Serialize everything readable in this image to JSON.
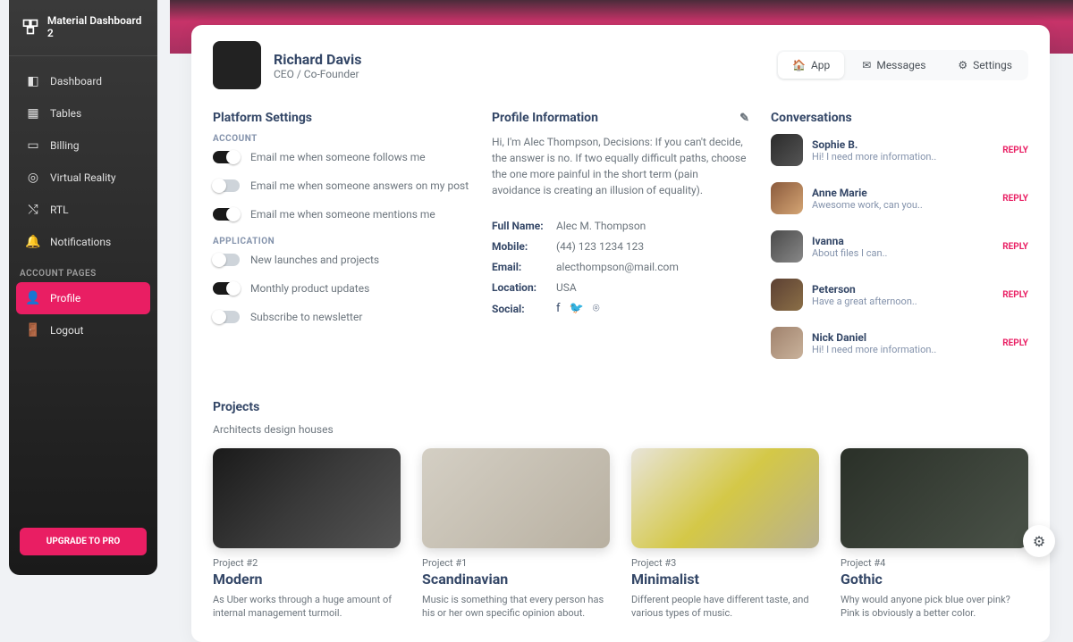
{
  "brand": "Material Dashboard 2",
  "sidebar": {
    "items": [
      {
        "label": "Dashboard"
      },
      {
        "label": "Tables"
      },
      {
        "label": "Billing"
      },
      {
        "label": "Virtual Reality"
      },
      {
        "label": "RTL"
      },
      {
        "label": "Notifications"
      }
    ],
    "account_header": "ACCOUNT PAGES",
    "account_items": [
      {
        "label": "Profile",
        "active": true
      },
      {
        "label": "Logout"
      }
    ],
    "upgrade": "UPGRADE TO PRO"
  },
  "profile": {
    "name": "Richard Davis",
    "role": "CEO / Co-Founder"
  },
  "tabs": [
    {
      "label": "App",
      "active": true
    },
    {
      "label": "Messages"
    },
    {
      "label": "Settings"
    }
  ],
  "settings": {
    "title": "Platform Settings",
    "account_header": "ACCOUNT",
    "application_header": "APPLICATION",
    "account": [
      {
        "label": "Email me when someone follows me",
        "on": true
      },
      {
        "label": "Email me when someone answers on my post",
        "on": false
      },
      {
        "label": "Email me when someone mentions me",
        "on": true
      }
    ],
    "application": [
      {
        "label": "New launches and projects",
        "on": false
      },
      {
        "label": "Monthly product updates",
        "on": true
      },
      {
        "label": "Subscribe to newsletter",
        "on": false
      }
    ]
  },
  "info": {
    "title": "Profile Information",
    "bio": "Hi, I'm Alec Thompson, Decisions: If you can't decide, the answer is no. If two equally difficult paths, choose the one more painful in the short term (pain avoidance is creating an illusion of equality).",
    "rows": {
      "fullname_label": "Full Name:",
      "fullname": "Alec M. Thompson",
      "mobile_label": "Mobile:",
      "mobile": "(44) 123 1234 123",
      "email_label": "Email:",
      "email": "alecthompson@mail.com",
      "location_label": "Location:",
      "location": "USA",
      "social_label": "Social:"
    }
  },
  "conversations": {
    "title": "Conversations",
    "reply": "REPLY",
    "items": [
      {
        "name": "Sophie B.",
        "msg": "Hi! I need more information.."
      },
      {
        "name": "Anne Marie",
        "msg": "Awesome work, can you.."
      },
      {
        "name": "Ivanna",
        "msg": "About files I can.."
      },
      {
        "name": "Peterson",
        "msg": "Have a great afternoon.."
      },
      {
        "name": "Nick Daniel",
        "msg": "Hi! I need more information.."
      }
    ]
  },
  "projects": {
    "title": "Projects",
    "subtitle": "Architects design houses",
    "items": [
      {
        "num": "Project #2",
        "name": "Modern",
        "desc": "As Uber works through a huge amount of internal management turmoil."
      },
      {
        "num": "Project #1",
        "name": "Scandinavian",
        "desc": "Music is something that every person has his or her own specific opinion about."
      },
      {
        "num": "Project #3",
        "name": "Minimalist",
        "desc": "Different people have different taste, and various types of music."
      },
      {
        "num": "Project #4",
        "name": "Gothic",
        "desc": "Why would anyone pick blue over pink? Pink is obviously a better color."
      }
    ]
  }
}
